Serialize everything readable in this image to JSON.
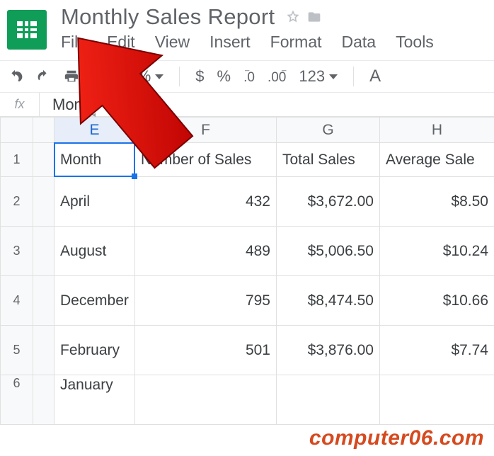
{
  "doc": {
    "title": "Monthly Sales Report"
  },
  "menu": {
    "file": "File",
    "edit": "Edit",
    "view": "View",
    "insert": "Insert",
    "format": "Format",
    "data": "Data",
    "tools": "Tools"
  },
  "toolbar": {
    "zoom": "100%",
    "currency": "$",
    "percent": "%",
    "dec_decrease": ".0",
    "dec_increase": ".00",
    "numfmt": "123",
    "font_abbrev": "A"
  },
  "fx": {
    "label": "fx",
    "value": "Month"
  },
  "columns": {
    "E": "E",
    "F": "F",
    "G": "G",
    "H": "H"
  },
  "headers": {
    "month": "Month",
    "num_sales": "Number of Sales",
    "total_sales": "Total Sales",
    "avg_sale": "Average Sale"
  },
  "rows": [
    {
      "n": "1"
    },
    {
      "n": "2",
      "month": "April",
      "num": "432",
      "total": "$3,672.00",
      "avg": "$8.50"
    },
    {
      "n": "3",
      "month": "August",
      "num": "489",
      "total": "$5,006.50",
      "avg": "$10.24"
    },
    {
      "n": "4",
      "month": "December",
      "num": "795",
      "total": "$8,474.50",
      "avg": "$10.66"
    },
    {
      "n": "5",
      "month": "February",
      "num": "501",
      "total": "$3,876.00",
      "avg": "$7.74"
    },
    {
      "n": "6",
      "month": "January",
      "num": "",
      "total": "",
      "avg": ""
    }
  ],
  "watermark": "computer06.com",
  "chart_data": {
    "type": "table",
    "title": "Monthly Sales Report",
    "columns": [
      "Month",
      "Number of Sales",
      "Total Sales",
      "Average Sale"
    ],
    "rows": [
      [
        "April",
        432,
        3672.0,
        8.5
      ],
      [
        "August",
        489,
        5006.5,
        10.24
      ],
      [
        "December",
        795,
        8474.5,
        10.66
      ],
      [
        "February",
        501,
        3876.0,
        7.74
      ]
    ]
  }
}
